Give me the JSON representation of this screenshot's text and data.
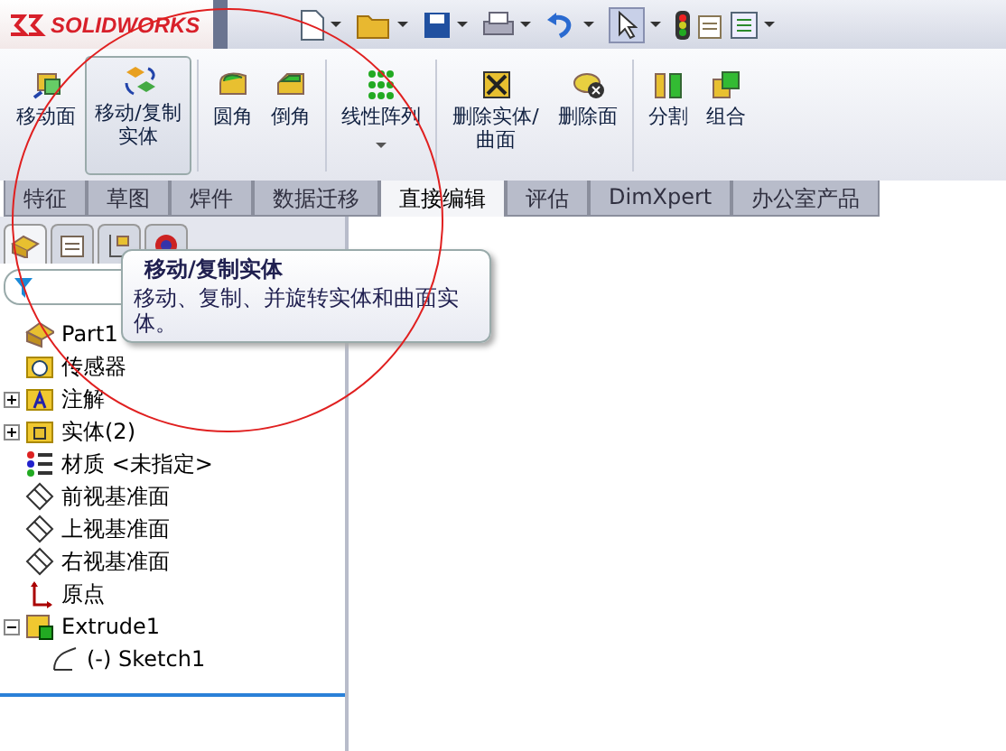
{
  "app": {
    "logo": "SOLIDWORKS"
  },
  "ribbon": {
    "commands": [
      {
        "label": "移动面",
        "pressed": false
      },
      {
        "label": "移动/复制实体",
        "pressed": true
      },
      {
        "label": "圆角",
        "pressed": false
      },
      {
        "label": "倒角",
        "pressed": false
      },
      {
        "label": "线性阵列",
        "pressed": false,
        "dropdown": true
      },
      {
        "label": "删除实体/曲面",
        "pressed": false
      },
      {
        "label": "删除面",
        "pressed": false
      },
      {
        "label": "分割",
        "pressed": false
      },
      {
        "label": "组合",
        "pressed": false
      }
    ]
  },
  "tabs": [
    {
      "label": "特征",
      "selected": false
    },
    {
      "label": "草图",
      "selected": false
    },
    {
      "label": "焊件",
      "selected": false
    },
    {
      "label": "数据迁移",
      "selected": false
    },
    {
      "label": "直接编辑",
      "selected": true
    },
    {
      "label": "评估",
      "selected": false
    },
    {
      "label": "DimXpert",
      "selected": false
    },
    {
      "label": "办公室产品",
      "selected": false
    }
  ],
  "tooltip": {
    "title": "移动/复制实体",
    "text": "移动、复制、并旋转实体和曲面实体。"
  },
  "tree": [
    {
      "label": "Part1",
      "kind": "part",
      "children": [
        {
          "label": "传感器",
          "kind": "sensor"
        },
        {
          "label": "注解",
          "kind": "annotation",
          "expanded": false
        },
        {
          "label": "实体(2)",
          "kind": "bodies",
          "expanded": false
        },
        {
          "label": "材质 <未指定>",
          "kind": "material"
        },
        {
          "label": "前视基准面",
          "kind": "plane"
        },
        {
          "label": "上视基准面",
          "kind": "plane"
        },
        {
          "label": "右视基准面",
          "kind": "plane"
        },
        {
          "label": "原点",
          "kind": "origin"
        },
        {
          "label": "Extrude1",
          "kind": "extrude",
          "expanded": true,
          "children": [
            {
              "label": "(-) Sketch1",
              "kind": "sketch"
            }
          ]
        }
      ]
    }
  ]
}
